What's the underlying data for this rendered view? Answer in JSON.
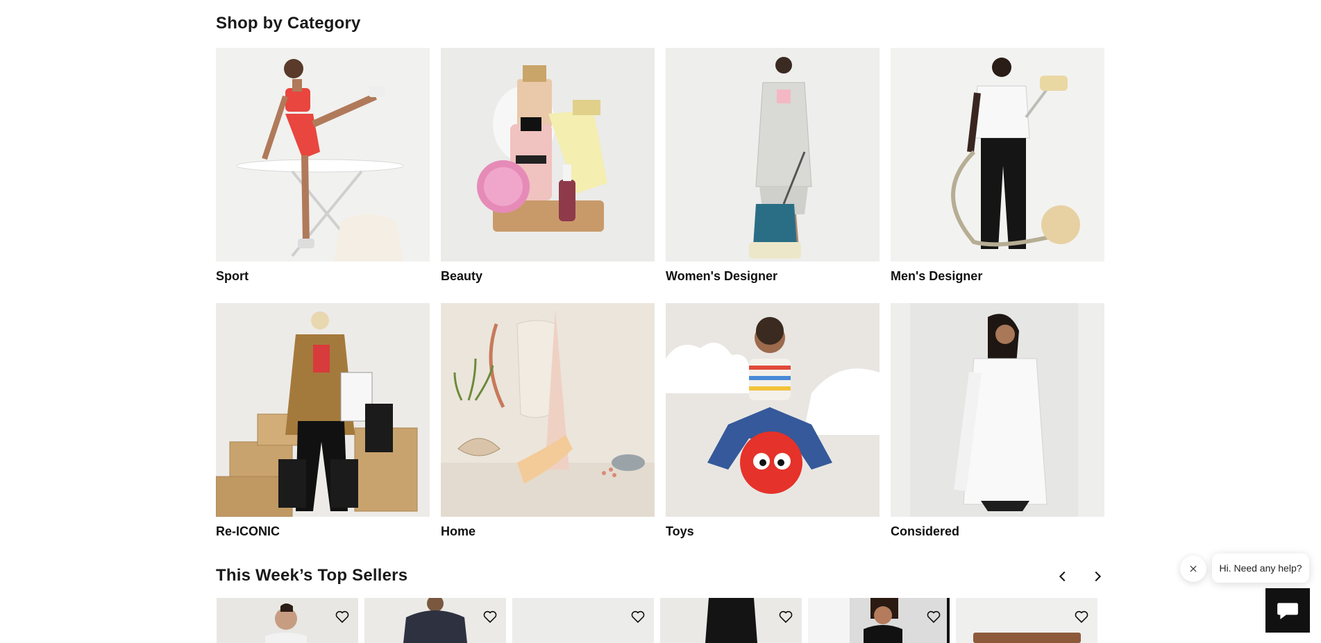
{
  "categories_section": {
    "title": "Shop by Category",
    "items": [
      {
        "label": "Sport",
        "image": "sport-photo"
      },
      {
        "label": "Beauty",
        "image": "beauty-photo"
      },
      {
        "label": "Women's Designer",
        "image": "womens-designer-photo"
      },
      {
        "label": "Men's Designer",
        "image": "mens-designer-photo"
      },
      {
        "label": "Re-ICONIC",
        "image": "re-iconic-photo"
      },
      {
        "label": "Home",
        "image": "home-photo"
      },
      {
        "label": "Toys",
        "image": "toys-photo"
      },
      {
        "label": "Considered",
        "image": "considered-photo"
      }
    ]
  },
  "top_sellers": {
    "title": "This Week’s Top Sellers",
    "prev_icon": "chevron-left-icon",
    "next_icon": "chevron-right-icon",
    "wishlist_icon": "heart-icon",
    "product_count": 6
  },
  "chat": {
    "greeting": "Hi. Need any help?",
    "close_icon": "close-icon",
    "launcher_icon": "chat-icon"
  },
  "colors": {
    "text": "#1a1a1a",
    "launcher": "#111111",
    "sport_red": "#e8463f",
    "toy_ball": "#e5322a"
  }
}
